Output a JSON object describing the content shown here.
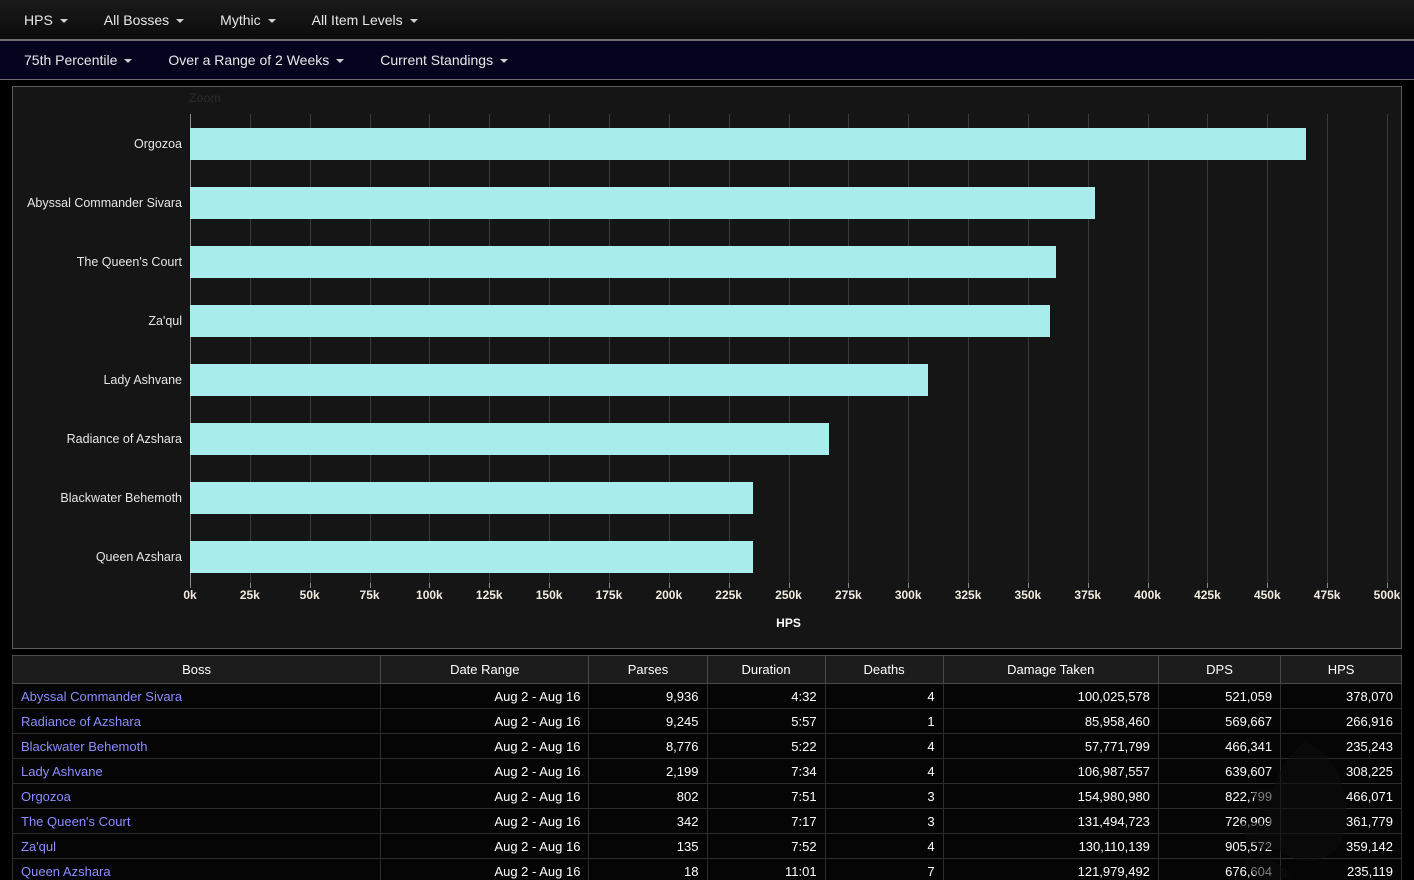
{
  "nav_primary": [
    {
      "label": "HPS",
      "name": "metric-selector"
    },
    {
      "label": "All Bosses",
      "name": "boss-selector"
    },
    {
      "label": "Mythic",
      "name": "difficulty-selector"
    },
    {
      "label": "All Item Levels",
      "name": "item-level-selector"
    }
  ],
  "nav_secondary": [
    {
      "label": "75th Percentile",
      "name": "percentile-selector"
    },
    {
      "label": "Over a Range of 2 Weeks",
      "name": "date-range-selector"
    },
    {
      "label": "Current Standings",
      "name": "standings-selector"
    }
  ],
  "chart": {
    "zoom_label": "Zoom"
  },
  "chart_data": {
    "type": "bar",
    "orientation": "horizontal",
    "title": "",
    "xlabel": "HPS",
    "ylabel": "",
    "xlim": [
      0,
      500000
    ],
    "xticks": [
      0,
      25000,
      50000,
      75000,
      100000,
      125000,
      150000,
      175000,
      200000,
      225000,
      250000,
      275000,
      300000,
      325000,
      350000,
      375000,
      400000,
      425000,
      450000,
      475000,
      500000
    ],
    "xtick_labels": [
      "0k",
      "25k",
      "50k",
      "75k",
      "100k",
      "125k",
      "150k",
      "175k",
      "200k",
      "225k",
      "250k",
      "275k",
      "300k",
      "325k",
      "350k",
      "375k",
      "400k",
      "425k",
      "450k",
      "475k",
      "500k"
    ],
    "grid": true,
    "legend": false,
    "bar_color": "#a9ecec",
    "categories": [
      "Orgozoa",
      "Abyssal Commander Sivara",
      "The Queen's Court",
      "Za'qul",
      "Lady Ashvane",
      "Radiance of Azshara",
      "Blackwater Behemoth",
      "Queen Azshara"
    ],
    "values": [
      466071,
      378070,
      361779,
      359142,
      308225,
      266916,
      235243,
      235119
    ]
  },
  "table": {
    "columns": [
      "Boss",
      "Date Range",
      "Parses",
      "Duration",
      "Deaths",
      "Damage Taken",
      "DPS",
      "HPS"
    ],
    "rows": [
      {
        "boss": "Abyssal Commander Sivara",
        "date_range": "Aug 2 - Aug 16",
        "parses": "9,936",
        "duration": "4:32",
        "deaths": "4",
        "damage_taken": "100,025,578",
        "dps": "521,059",
        "hps": "378,070"
      },
      {
        "boss": "Radiance of Azshara",
        "date_range": "Aug 2 - Aug 16",
        "parses": "9,245",
        "duration": "5:57",
        "deaths": "1",
        "damage_taken": "85,958,460",
        "dps": "569,667",
        "hps": "266,916"
      },
      {
        "boss": "Blackwater Behemoth",
        "date_range": "Aug 2 - Aug 16",
        "parses": "8,776",
        "duration": "5:22",
        "deaths": "4",
        "damage_taken": "57,771,799",
        "dps": "466,341",
        "hps": "235,243"
      },
      {
        "boss": "Lady Ashvane",
        "date_range": "Aug 2 - Aug 16",
        "parses": "2,199",
        "duration": "7:34",
        "deaths": "4",
        "damage_taken": "106,987,557",
        "dps": "639,607",
        "hps": "308,225"
      },
      {
        "boss": "Orgozoa",
        "date_range": "Aug 2 - Aug 16",
        "parses": "802",
        "duration": "7:51",
        "deaths": "3",
        "damage_taken": "154,980,980",
        "dps": "822,799",
        "hps": "466,071"
      },
      {
        "boss": "The Queen's Court",
        "date_range": "Aug 2 - Aug 16",
        "parses": "342",
        "duration": "7:17",
        "deaths": "3",
        "damage_taken": "131,494,723",
        "dps": "726,909",
        "hps": "361,779"
      },
      {
        "boss": "Za'qul",
        "date_range": "Aug 2 - Aug 16",
        "parses": "135",
        "duration": "7:52",
        "deaths": "4",
        "damage_taken": "130,110,139",
        "dps": "905,572",
        "hps": "359,142"
      },
      {
        "boss": "Queen Azshara",
        "date_range": "Aug 2 - Aug 16",
        "parses": "18",
        "duration": "11:01",
        "deaths": "7",
        "damage_taken": "121,979,492",
        "dps": "676,604",
        "hps": "235,119"
      }
    ]
  },
  "colors": {
    "bar": "#a9ecec",
    "hps_text": "#c4f79a",
    "link": "#8d8dff",
    "nav_secondary_bg": "#04041f"
  }
}
